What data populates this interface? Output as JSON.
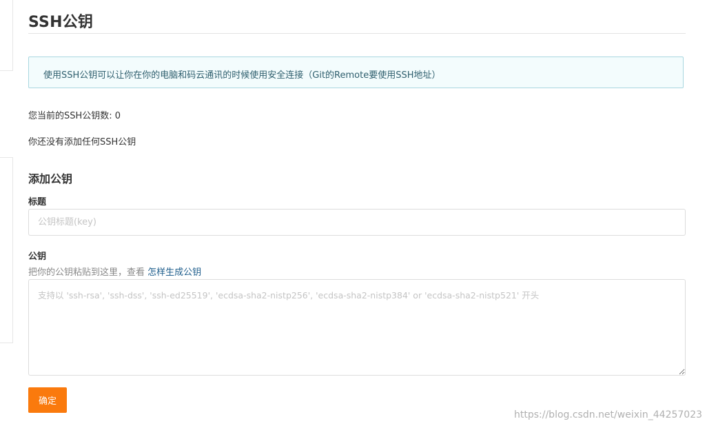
{
  "page": {
    "title": "SSH公钥"
  },
  "info_alert": {
    "text": "使用SSH公钥可以让你在你的电脑和码云通讯的时候使用安全连接（Git的Remote要使用SSH地址）"
  },
  "status": {
    "key_count_label": "您当前的SSH公钥数: 0",
    "empty_message": "你还没有添加任何SSH公钥"
  },
  "add_key_form": {
    "heading": "添加公钥",
    "title_label": "标题",
    "title_placeholder": "公钥标题(key)",
    "title_value": "",
    "key_label": "公钥",
    "key_hint_prefix": "把你的公钥粘贴到这里，查看 ",
    "key_hint_link": "怎样生成公钥",
    "key_placeholder": "支持以 'ssh-rsa', 'ssh-dss', 'ssh-ed25519', 'ecdsa-sha2-nistp256', 'ecdsa-sha2-nistp384' or 'ecdsa-sha2-nistp521' 开头",
    "key_value": "",
    "submit_label": "确定"
  },
  "watermark": {
    "text": "https://blog.csdn.net/weixin_44257023"
  },
  "colors": {
    "accent": "#fa7a0d",
    "link": "#1f5e8c",
    "alert_border": "#a9d7e0",
    "alert_background": "#f3fcfd"
  }
}
